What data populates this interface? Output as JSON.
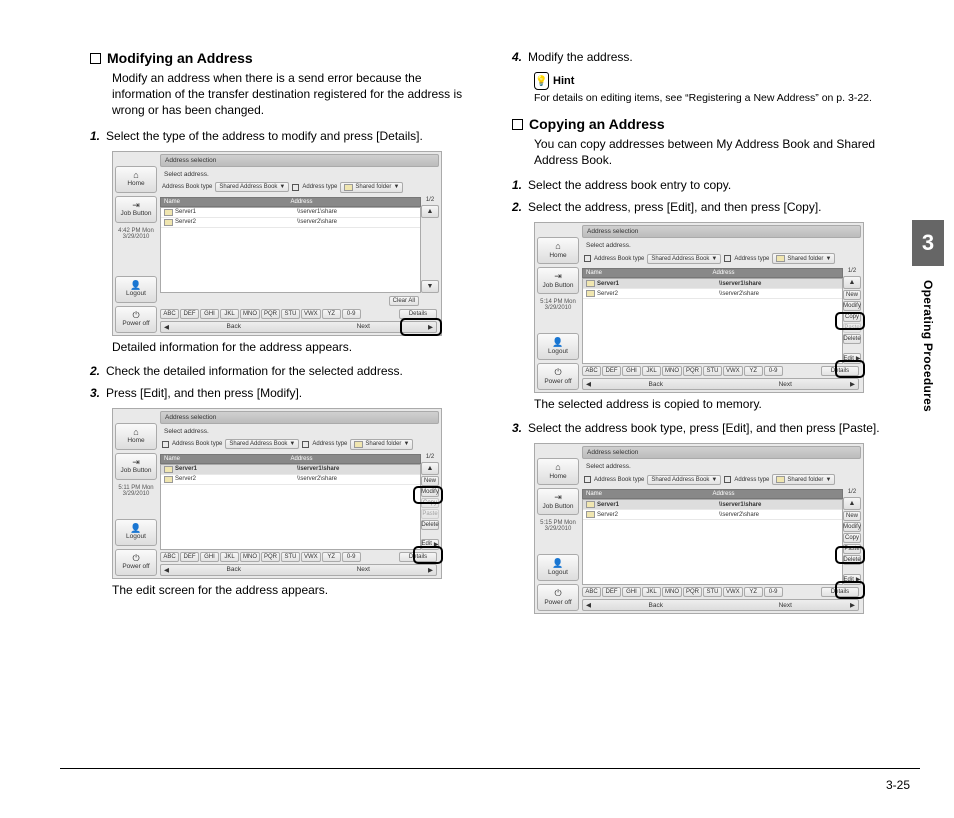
{
  "sideTab": {
    "num": "3",
    "label": "Operating Procedures"
  },
  "footerPage": "3-25",
  "left": {
    "heading1": "Modifying an Address",
    "intro1": "Modify an address when there is a send error because the information of the transfer destination registered for the address is wrong or has been changed.",
    "step1": "Select the type of the address to modify and press [Details].",
    "caption1": "Detailed information for the address appears.",
    "step2": "Check the detailed information for the selected address.",
    "step3": "Press [Edit], and then press [Modify].",
    "caption2": "The edit screen for the address appears."
  },
  "right": {
    "step4": "Modify the address.",
    "hintTitle": "Hint",
    "hintBody": "For details on editing items, see “Registering a New Address” on p. 3-22.",
    "heading2": "Copying an Address",
    "intro2": "You can copy addresses between My Address Book and Shared Address Book.",
    "step1": "Select the address book entry to copy.",
    "step2": "Select the address, press [Edit], and then press [Copy].",
    "caption1": "The selected address is copied to memory.",
    "step3": "Select the address book type, press [Edit], and then press [Paste]."
  },
  "ui": {
    "titlebar": "Address selection",
    "instr": "Select address.",
    "labelBook": "Address Book type",
    "valBook": "Shared Address Book",
    "labelAddr": "Address type",
    "valAddr": "Shared folder",
    "thName": "Name",
    "thAddr": "Address",
    "r1n": "Server1",
    "r1a": "\\\\server1\\share",
    "r2n": "Server2",
    "r2a": "\\\\server2\\share",
    "pagenum": "1/2",
    "clear": "Clear All",
    "details": "Details",
    "edit": "Edit",
    "new": "New",
    "modify": "Modify",
    "copy": "Copy",
    "paste": "Paste",
    "delete": "Delete",
    "back": "Back",
    "next": "Next",
    "alpha": [
      "ABC",
      "DEF",
      "GHI",
      "JKL",
      "MNO",
      "PQR",
      "STU",
      "VWX",
      "YZ",
      "0-9"
    ],
    "side": {
      "home": "Home",
      "job": "Job Button",
      "logout": "Logout",
      "power": "Power off",
      "t1": "4:42 PM  Mon\n3/29/2010",
      "t2": "5:11 PM  Mon\n3/29/2010",
      "t3": "5:14 PM  Mon\n3/29/2010",
      "t4": "5:15 PM  Mon\n3/29/2010"
    }
  }
}
